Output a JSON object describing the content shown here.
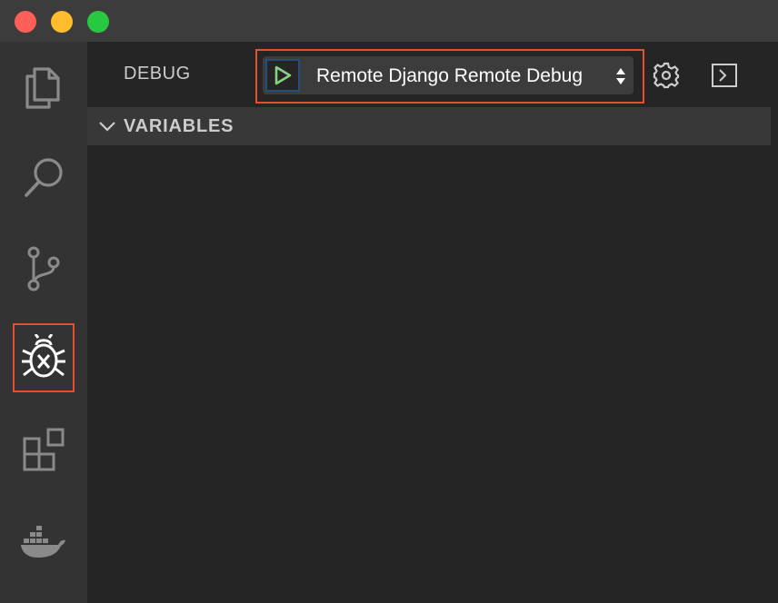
{
  "window": {
    "controls": [
      "close",
      "minimize",
      "maximize"
    ],
    "accent_color": "#e4502f"
  },
  "activity_bar": {
    "items": [
      {
        "name": "explorer",
        "icon": "files-icon",
        "active": false
      },
      {
        "name": "search",
        "icon": "search-icon",
        "active": false
      },
      {
        "name": "source-control",
        "icon": "source-control-icon",
        "active": false
      },
      {
        "name": "debug",
        "icon": "bug-icon",
        "active": true
      },
      {
        "name": "extensions",
        "icon": "extensions-icon",
        "active": false
      },
      {
        "name": "docker",
        "icon": "docker-whale-icon",
        "active": false
      }
    ]
  },
  "debug": {
    "title": "DEBUG",
    "configuration": "Remote Django Remote Debug",
    "start_icon": "play-icon",
    "start_color": "#89d185",
    "settings_icon": "gear-icon",
    "console_icon": "console-icon"
  },
  "variables": {
    "title": "VARIABLES",
    "expanded": true
  }
}
